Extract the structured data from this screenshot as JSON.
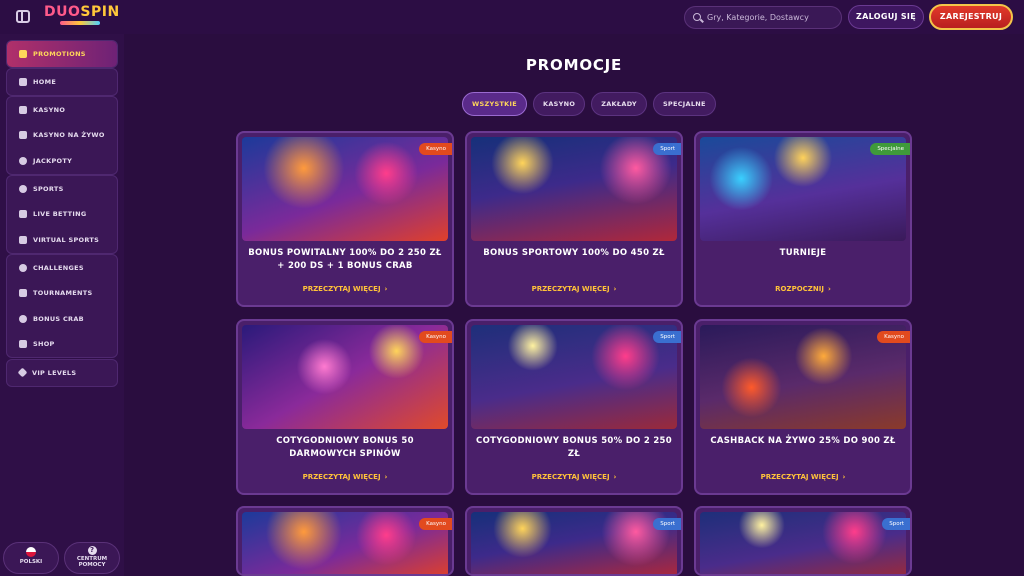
{
  "header": {
    "logo_part1": "DUO",
    "logo_part2": "SPIN",
    "search_placeholder": "Gry, Kategorie, Dostawcy",
    "login_label": "ZALOGUJ SIĘ",
    "register_label": "ZAREJESTRUJ"
  },
  "sidebar": {
    "groups": [
      [
        {
          "label": "PROMOTIONS",
          "icon": "gift-icon",
          "active": true
        }
      ],
      [
        {
          "label": "HOME",
          "icon": "home-icon"
        }
      ],
      [
        {
          "label": "KASYNO",
          "icon": "slot-icon"
        },
        {
          "label": "KASYNO NA ŻYWO",
          "icon": "cards-icon"
        },
        {
          "label": "JACKPOTY",
          "icon": "clover-icon"
        }
      ],
      [
        {
          "label": "SPORTS",
          "icon": "ball-icon"
        },
        {
          "label": "LIVE BETTING",
          "icon": "play-icon"
        },
        {
          "label": "VIRTUAL SPORTS",
          "icon": "vr-icon"
        }
      ],
      [
        {
          "label": "CHALLENGES",
          "icon": "medal-icon"
        },
        {
          "label": "TOURNAMENTS",
          "icon": "trophy-icon"
        },
        {
          "label": "BONUS CRAB",
          "icon": "crab-icon"
        },
        {
          "label": "SHOP",
          "icon": "bag-icon"
        }
      ],
      [
        {
          "label": "VIP LEVELS",
          "icon": "diamond-icon"
        }
      ]
    ],
    "language_label": "POLSKI",
    "help_label_1": "CENTRUM",
    "help_label_2": "POMOCY"
  },
  "main": {
    "title": "PROMOCJE",
    "tabs": [
      "WSZYSTKIE",
      "KASYNO",
      "ZAKŁADY",
      "SPECJALNE"
    ],
    "active_tab": "WSZYSTKIE",
    "cards": [
      {
        "badge": "Kasyno",
        "title": "BONUS POWITALNY 100% DO 2 250 ZŁ + 200 DS + 1 BONUS CRAB",
        "cta": "PRZECZYTAJ WIĘCEJ"
      },
      {
        "badge": "Sport",
        "title": "BONUS SPORTOWY 100% DO 450 ZŁ",
        "cta": "PRZECZYTAJ WIĘCEJ"
      },
      {
        "badge": "Specjalne",
        "title": "TURNIEJE",
        "cta": "ROZPOCZNIJ"
      },
      {
        "badge": "Kasyno",
        "title": "COTYGODNIOWY BONUS 50 DARMOWYCH SPINÓW",
        "cta": "PRZECZYTAJ WIĘCEJ"
      },
      {
        "badge": "Sport",
        "title": "COTYGODNIOWY BONUS 50% DO 2 250 ZŁ",
        "cta": "PRZECZYTAJ WIĘCEJ"
      },
      {
        "badge": "Kasyno",
        "title": "CASHBACK NA ŻYWO 25% DO 900 ZŁ",
        "cta": "PRZECZYTAJ WIĘCEJ"
      },
      {
        "badge": "Kasyno"
      },
      {
        "badge": "Sport"
      },
      {
        "badge": "Sport"
      }
    ]
  }
}
